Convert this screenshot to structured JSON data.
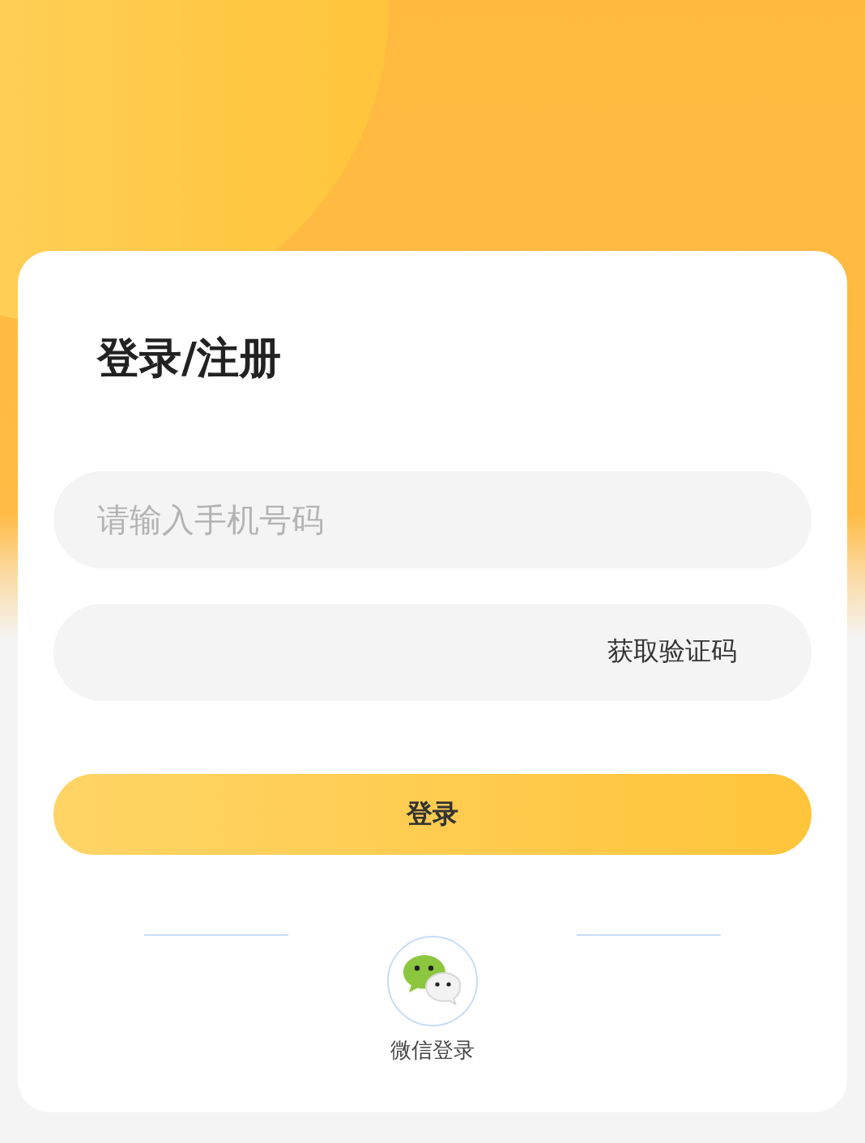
{
  "title": "登录/注册",
  "phone_field": {
    "placeholder": "请输入手机号码"
  },
  "code_field": {
    "action": "获取验证码"
  },
  "login_button": {
    "label": "登录"
  },
  "social_login": {
    "label": "微信登录"
  }
}
